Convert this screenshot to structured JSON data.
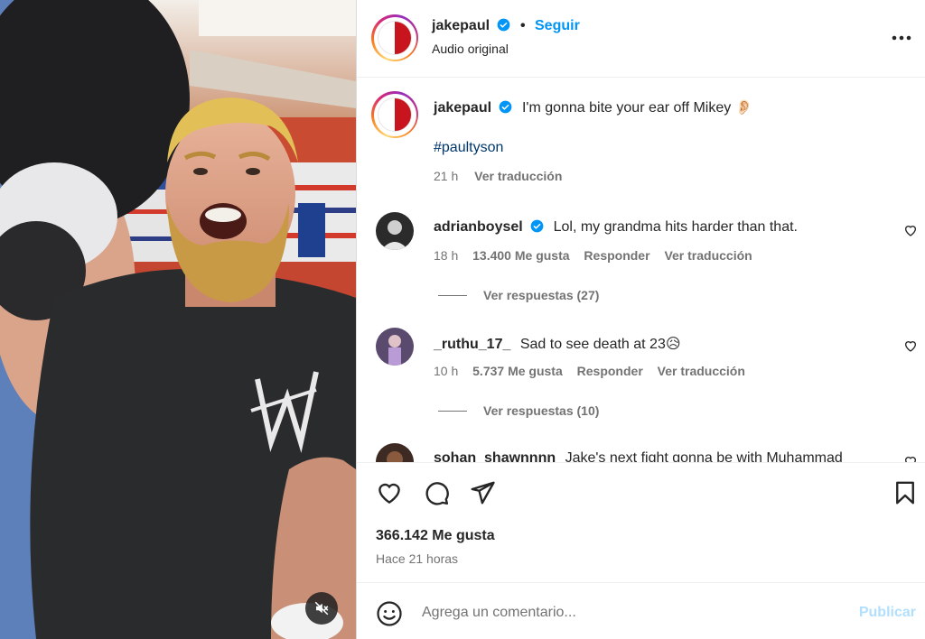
{
  "post": {
    "username": "jakepaul",
    "separator": "•",
    "follow_label": "Seguir",
    "audio_label": "Audio original"
  },
  "caption": {
    "username": "jakepaul",
    "text": "I'm gonna bite your ear off Mikey 👂🏻",
    "hashtag": "#paultyson",
    "time": "21 h",
    "translate_label": "Ver traducción"
  },
  "comments": [
    {
      "username": "adrianboysel",
      "verified": true,
      "text": "Lol, my grandma hits harder than that.",
      "time": "18 h",
      "likes": "13.400 Me gusta",
      "reply_label": "Responder",
      "translate_label": "Ver traducción",
      "replies_label": "Ver respuestas (27)"
    },
    {
      "username": "_ruthu_17_",
      "verified": false,
      "text": "Sad to see death at 23😥",
      "time": "10 h",
      "likes": "5.737 Me gusta",
      "reply_label": "Responder",
      "translate_label": "Ver traducción",
      "replies_label": "Ver respuestas (10)"
    },
    {
      "username": "sohan_shawnnnn",
      "verified": false,
      "text": "Jake's next fight gonna be with Muhammad"
    }
  ],
  "footer": {
    "likes": "366.142 Me gusta",
    "time_ago": "Hace 21 horas"
  },
  "composer": {
    "placeholder": "Agrega un comentario...",
    "post_label": "Publicar"
  },
  "colors": {
    "accent": "#0095f6",
    "hashtag": "#00376b",
    "muted": "#737373",
    "text": "#262626"
  },
  "icons": [
    "verified-badge-icon",
    "more-options-icon",
    "heart-icon",
    "comment-icon",
    "share-icon",
    "bookmark-icon",
    "emoji-icon",
    "muted-audio-icon"
  ]
}
